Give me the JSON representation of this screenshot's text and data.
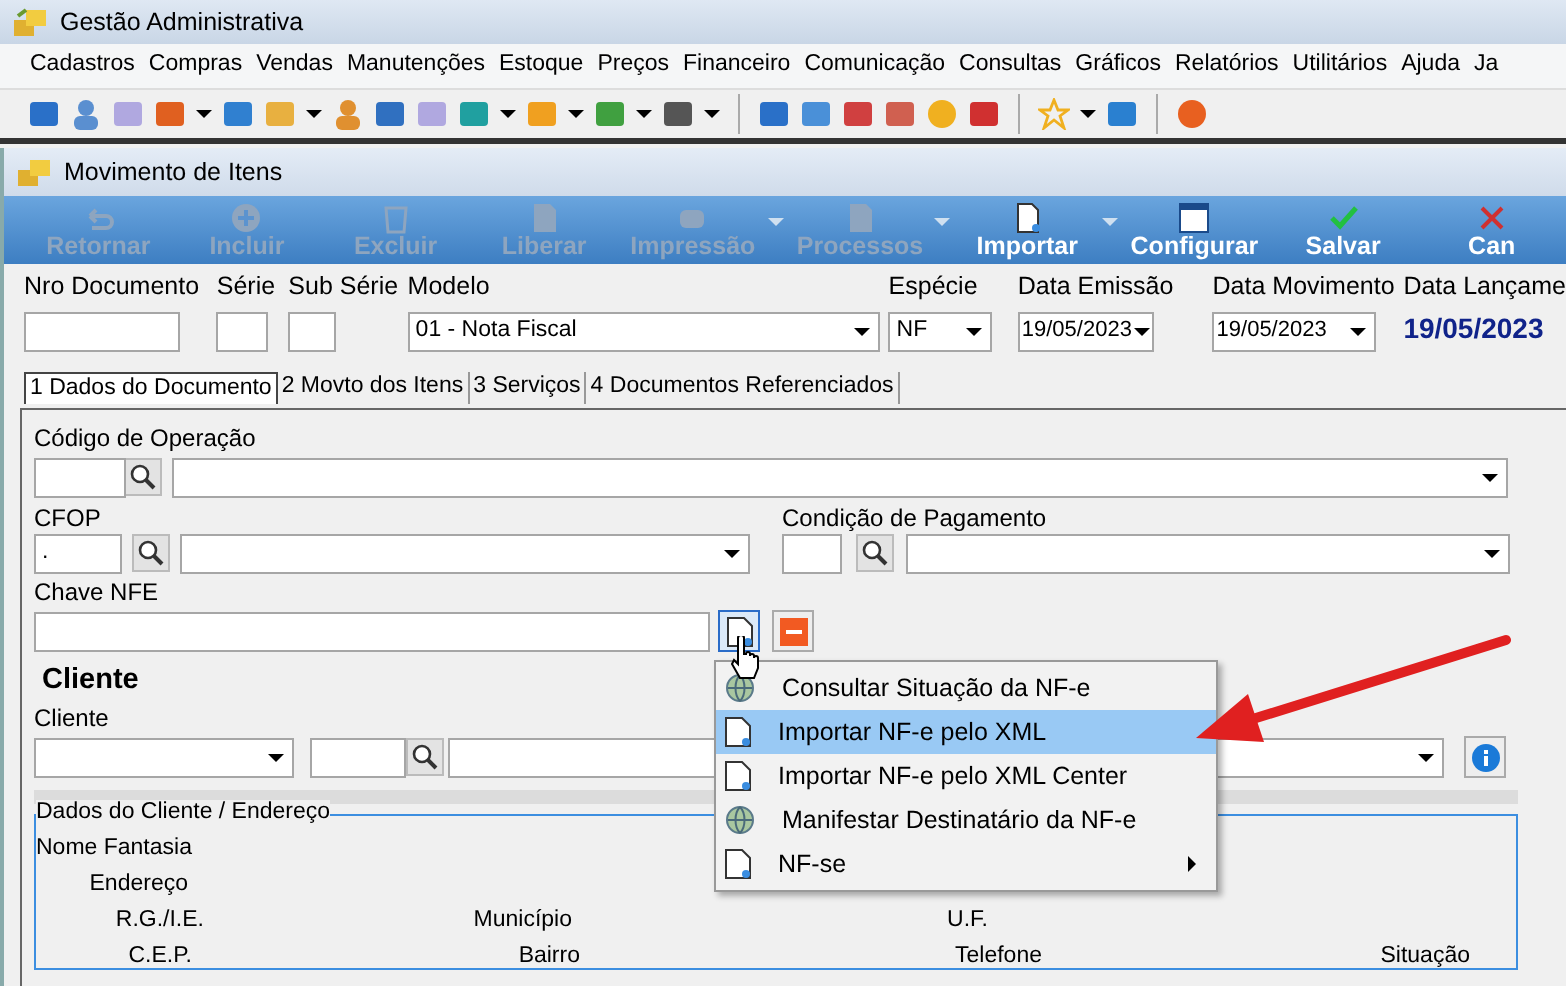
{
  "window": {
    "title": "Gestão Administrativa"
  },
  "menu": [
    "Cadastros",
    "Compras",
    "Vendas",
    "Manutenções",
    "Estoque",
    "Preços",
    "Financeiro",
    "Comunicação",
    "Consultas",
    "Gráficos",
    "Relatórios",
    "Utilitários",
    "Ajuda",
    "Ja"
  ],
  "child_window": {
    "title": "Movimento de Itens"
  },
  "actions": [
    {
      "label": "Retornar",
      "kind": "back",
      "disabled": true,
      "dropdown": false
    },
    {
      "label": "Incluir",
      "kind": "plus",
      "disabled": true,
      "dropdown": false
    },
    {
      "label": "Excluir",
      "kind": "bin",
      "disabled": true,
      "dropdown": false
    },
    {
      "label": "Liberar",
      "kind": "page",
      "disabled": true,
      "dropdown": false
    },
    {
      "label": "Impressão",
      "kind": "printer",
      "disabled": true,
      "dropdown": true
    },
    {
      "label": "Processos",
      "kind": "page",
      "disabled": true,
      "dropdown": true
    },
    {
      "label": "Importar",
      "kind": "doc",
      "disabled": false,
      "dropdown": true
    },
    {
      "label": "Configurar",
      "kind": "window",
      "disabled": false,
      "dropdown": false
    },
    {
      "label": "Salvar",
      "kind": "check",
      "disabled": false,
      "dropdown": false
    },
    {
      "label": "Can",
      "kind": "cross",
      "disabled": false,
      "dropdown": false
    }
  ],
  "header": [
    {
      "label": "Nro Documento",
      "kind": "text"
    },
    {
      "label": "Série",
      "kind": "text"
    },
    {
      "label": "Sub Série",
      "kind": "text"
    },
    {
      "label": "Modelo",
      "kind": "combo",
      "value": "01 - Nota Fiscal"
    },
    {
      "label": "Espécie",
      "kind": "combo",
      "value": "NF"
    },
    {
      "label": "Data Emissão",
      "kind": "combo",
      "value": "19/05/2023"
    },
    {
      "label": "Data Movimento",
      "kind": "combo",
      "value": "19/05/2023"
    },
    {
      "label": "Data Lançame",
      "kind": "readout",
      "value": "19/05/2023"
    }
  ],
  "tabs": [
    {
      "label": "1 Dados do Documento",
      "selected": true
    },
    {
      "label": "2 Movto dos Itens",
      "selected": false
    },
    {
      "label": "3 Serviços",
      "selected": false
    },
    {
      "label": "4 Documentos Referenciados",
      "selected": false
    }
  ],
  "form": {
    "operacao_label": "Código de Operação",
    "cfop_label": "CFOP",
    "cfop_value": ".",
    "pagamento_label": "Condição de Pagamento",
    "chave_label": "Chave NFE",
    "cliente_section": "Cliente",
    "cliente_label": "Cliente",
    "group": {
      "title": "Dados do Cliente / Endereço",
      "rows": [
        [
          "Nome Fantasia"
        ],
        [
          "Endereço"
        ],
        [
          "R.G./I.E.",
          "Município",
          "U.F."
        ],
        [
          "C.E.P.",
          "Bairro",
          "Telefone",
          "Situação"
        ]
      ]
    }
  },
  "context_menu": [
    {
      "label": "Consultar Situação da NF-e",
      "kind": "globe",
      "selected": false,
      "submenu": false
    },
    {
      "label": "Importar NF-e pelo XML",
      "kind": "doc",
      "selected": true,
      "submenu": false
    },
    {
      "label": "Importar NF-e pelo XML Center",
      "kind": "doc",
      "selected": false,
      "submenu": false
    },
    {
      "label": "Manifestar Destinatário da NF-e",
      "kind": "globe",
      "selected": false,
      "submenu": false
    },
    {
      "label": "NF-se",
      "kind": "doc",
      "selected": false,
      "submenu": true
    }
  ]
}
